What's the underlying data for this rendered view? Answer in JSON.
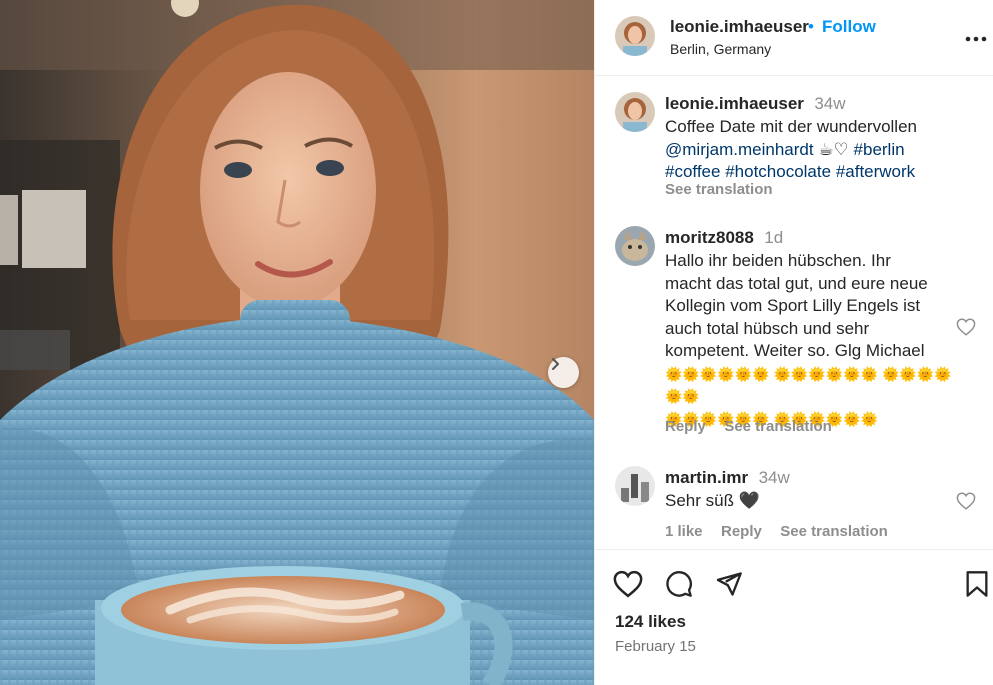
{
  "post": {
    "username": "leonie.imhaeuser",
    "separator": "•",
    "follow_label": "Follow",
    "location": "Berlin, Germany",
    "more_label": "•••",
    "caption": {
      "username": "leonie.imhaeuser",
      "time": "34w",
      "line1": "Coffee Date mit der wundervollen",
      "mention": "@mirjam.meinhardt",
      "emoji": "☕♡",
      "tag_berlin": "#berlin",
      "tag_coffee": "#coffee",
      "tag_hotchocolate": "#hotchocolate",
      "tag_afterwork": "#afterwork",
      "see_translation": "See translation"
    },
    "comments": [
      {
        "username": "moritz8088",
        "time": "1d",
        "lines": [
          "Hallo ihr beiden hübschen. Ihr",
          "macht das total gut, und eure neue",
          "Kollegin vom Sport Lilly Engels ist",
          "auch total hübsch und sehr",
          "kompetent. Weiter so. Glg Michael",
          "🌞🌞🌞🌞🌞🌞 🌞🌞🌞🌞🌞🌞 🌞🌞🌞🌞🌞🌞",
          "🌞🌞🌞🌞🌞🌞 🌞🌞🌞🌞🌞🌞"
        ],
        "reply_label": "Reply",
        "translation_label": "See translation"
      },
      {
        "username": "martin.imr",
        "time": "34w",
        "text": "Sehr süß 🖤",
        "likes_label": "1 like",
        "reply_label": "Reply",
        "translation_label": "See translation"
      }
    ],
    "likes": "124 likes",
    "date": "February 15"
  },
  "icons": [
    "chevron-right-icon",
    "heart-icon",
    "comment-icon",
    "share-icon",
    "bookmark-icon",
    "more-icon"
  ],
  "colors": {
    "link_blue": "#0095f6",
    "tag_blue": "#00376b",
    "secondary_text": "#8e8e8e",
    "sweater_blue": "#7fb0cc"
  }
}
